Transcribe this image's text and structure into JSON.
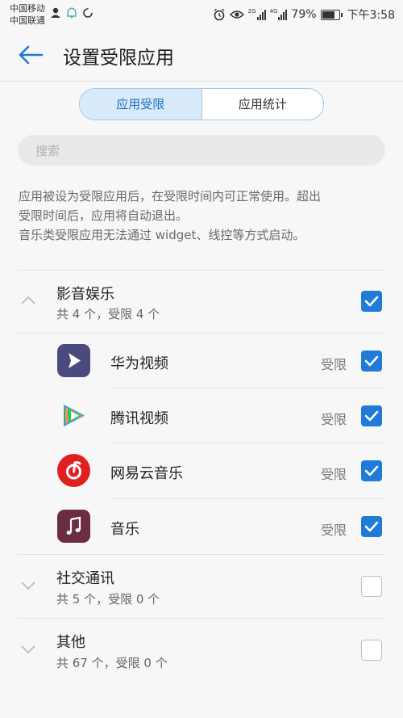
{
  "status_bar": {
    "carrier1": "中国移动",
    "carrier2": "中国联通",
    "net1": "2G",
    "net2": "4G",
    "battery": "79%",
    "time": "下午3:58"
  },
  "header": {
    "title": "设置受限应用"
  },
  "tabs": [
    {
      "label": "应用受限",
      "active": true
    },
    {
      "label": "应用统计",
      "active": false
    }
  ],
  "search": {
    "placeholder": "搜索"
  },
  "description": [
    "应用被设为受限应用后，在受限时间内可正常使用。超出",
    "受限时间后，应用将自动退出。",
    "音乐类受限应用无法通过 widget、线控等方式启动。"
  ],
  "categories": [
    {
      "title": "影音娱乐",
      "summary": "共 4 个，受限 4 个",
      "expanded": true,
      "checked": true,
      "apps": [
        {
          "name": "华为视频",
          "status": "受限",
          "checked": true,
          "icon": "huawei-video-icon"
        },
        {
          "name": "腾讯视频",
          "status": "受限",
          "checked": true,
          "icon": "tencent-video-icon"
        },
        {
          "name": "网易云音乐",
          "status": "受限",
          "checked": true,
          "icon": "netease-music-icon"
        },
        {
          "name": "音乐",
          "status": "受限",
          "checked": true,
          "icon": "music-icon"
        }
      ]
    },
    {
      "title": "社交通讯",
      "summary": "共 5 个，受限 0 个",
      "expanded": false,
      "checked": false
    },
    {
      "title": "其他",
      "summary": "共 67 个，受限 0 个",
      "expanded": false,
      "checked": false
    }
  ],
  "colors": {
    "accent": "#1f7ad8",
    "tab_active_bg": "#d9ebfa"
  }
}
